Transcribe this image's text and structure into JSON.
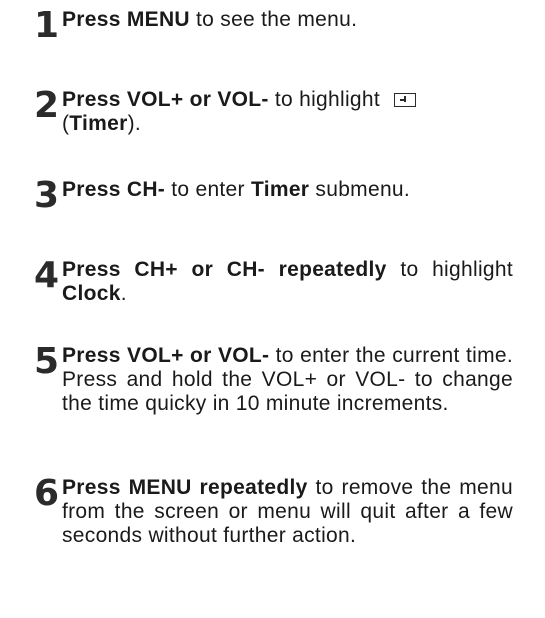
{
  "steps": [
    {
      "number": "1",
      "bold": "Press MENU",
      "rest": " to see the menu."
    },
    {
      "number": "2",
      "bold": "Press VOL+ or VOL-",
      "rest": " to highlight ",
      "icon": "timer-icon",
      "open": "(",
      "bold2": "Timer",
      "close": ")."
    },
    {
      "number": "3",
      "bold": "Press CH-",
      "rest": " to enter ",
      "bold2": "Timer",
      "rest2": " submenu."
    },
    {
      "number": "4",
      "bold": "Press CH+ or CH- repeatedly",
      "rest": " to highlight ",
      "bold2": "Clock",
      "rest2": "."
    },
    {
      "number": "5",
      "bold": "Press VOL+ or VOL-",
      "rest": " to enter the current time. Press and hold the VOL+ or VOL- to change the time quicky in 10 minute increments."
    },
    {
      "number": "6",
      "bold": "Press MENU repeatedly",
      "rest": " to remove the menu from the screen or menu will quit after a few seconds without further action."
    }
  ]
}
